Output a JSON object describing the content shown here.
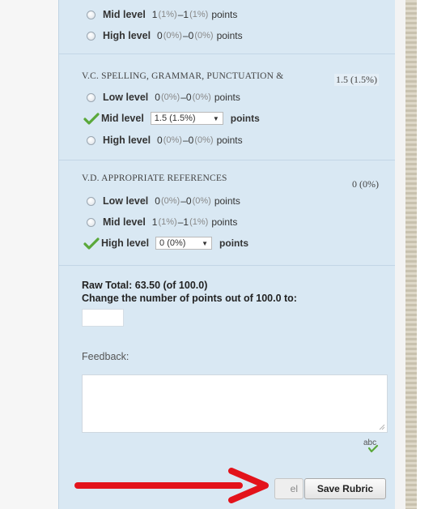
{
  "criteria": [
    {
      "title": "",
      "score": "",
      "levels": [
        {
          "name": "Mid level",
          "min": "1",
          "min_pct": "(1%)",
          "max": "1",
          "max_pct": "(1%)",
          "suffix": "points",
          "selected": false
        },
        {
          "name": "High level",
          "min": "0",
          "min_pct": "(0%)",
          "max": "0",
          "max_pct": "(0%)",
          "suffix": "points",
          "selected": false
        }
      ]
    },
    {
      "title": "V.C. SPELLING, GRAMMAR, PUNCTUATION &",
      "score": "1.5 (1.5%)",
      "levels": [
        {
          "name": "Low level",
          "min": "0",
          "min_pct": "(0%)",
          "max": "0",
          "max_pct": "(0%)",
          "suffix": "points",
          "selected": false
        },
        {
          "name": "Mid level",
          "dropdown_value": "1.5 (1.5%)",
          "suffix": "points",
          "selected": true
        },
        {
          "name": "High level",
          "min": "0",
          "min_pct": "(0%)",
          "max": "0",
          "max_pct": "(0%)",
          "suffix": "points",
          "selected": false
        }
      ]
    },
    {
      "title": "V.D. APPROPRIATE REFERENCES",
      "score": "0 (0%)",
      "levels": [
        {
          "name": "Low level",
          "min": "0",
          "min_pct": "(0%)",
          "max": "0",
          "max_pct": "(0%)",
          "suffix": "points",
          "selected": false
        },
        {
          "name": "Mid level",
          "min": "1",
          "min_pct": "(1%)",
          "max": "1",
          "max_pct": "(1%)",
          "suffix": "points",
          "selected": false
        },
        {
          "name": "High level",
          "dropdown_value": "0 (0%)",
          "suffix": "points",
          "selected": true
        }
      ]
    }
  ],
  "summary": {
    "raw_total": "Raw Total: 63.50 (of 100.0)",
    "change_points": "Change the number of points out of 100.0 to:"
  },
  "feedback": {
    "label": "Feedback:",
    "value": ""
  },
  "buttons": {
    "cancel_label": "el",
    "save_label": "Save Rubric"
  },
  "icons": {
    "check": "check-icon",
    "spellcheck": "spellcheck-icon",
    "arrow": "red-arrow-icon"
  },
  "colors": {
    "panel_bg": "#d9e8f3",
    "check_green": "#5aa83a",
    "arrow_red": "#e3131b"
  }
}
